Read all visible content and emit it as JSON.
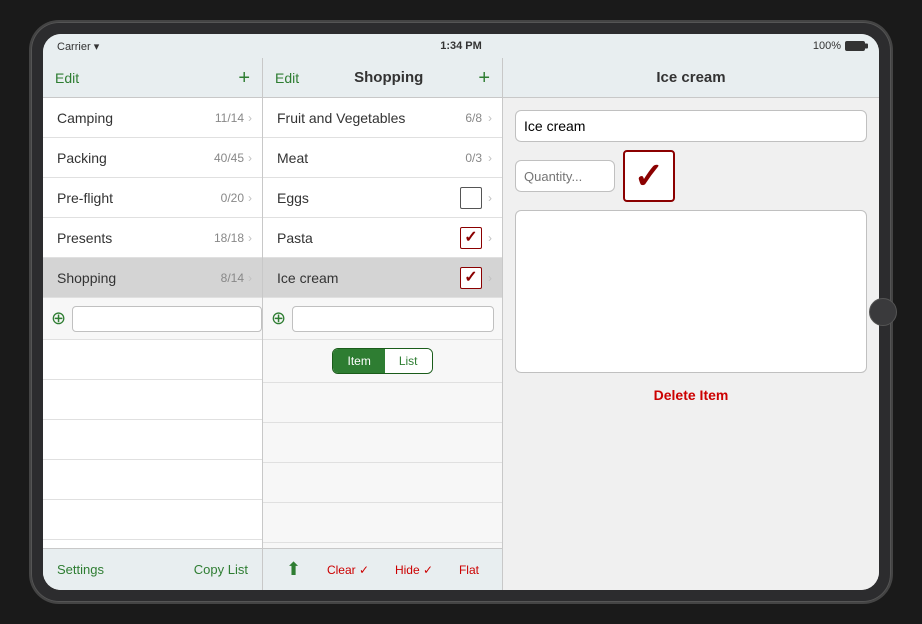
{
  "statusBar": {
    "carrier": "Carrier",
    "wifi": "▾",
    "time": "1:34 PM",
    "battery": "100%"
  },
  "leftPanel": {
    "editLabel": "Edit",
    "addLabel": "+",
    "lists": [
      {
        "name": "Camping",
        "count": "11/14"
      },
      {
        "name": "Packing",
        "count": "40/45"
      },
      {
        "name": "Pre-flight",
        "count": "0/20"
      },
      {
        "name": "Presents",
        "count": "18/18"
      },
      {
        "name": "Shopping",
        "count": "8/14",
        "active": true
      }
    ],
    "addInputPlaceholder": "",
    "footer": {
      "settings": "Settings",
      "copyList": "Copy List"
    }
  },
  "middlePanel": {
    "editLabel": "Edit",
    "addLabel": "+",
    "title": "Shopping",
    "items": [
      {
        "name": "Fruit and Vegetables",
        "count": "6/8",
        "checked": false,
        "active": false
      },
      {
        "name": "Meat",
        "count": "0/3",
        "checked": false,
        "active": false
      },
      {
        "name": "Eggs",
        "count": "",
        "checked": false,
        "active": false
      },
      {
        "name": "Pasta",
        "count": "",
        "checked": true,
        "active": false
      },
      {
        "name": "Ice cream",
        "count": "",
        "checked": true,
        "active": true
      }
    ],
    "addInputPlaceholder": "",
    "footer": {
      "clearLabel": "Clear ✓",
      "hideLabel": "Hide ✓",
      "flatLabel": "Flat"
    },
    "toggle": {
      "item": "Item",
      "list": "List",
      "active": "item"
    }
  },
  "rightPanel": {
    "title": "Ice cream",
    "itemName": "Ice cream",
    "quantityPlaceholder": "Quantity...",
    "checked": true,
    "deleteLabel": "Delete Item"
  }
}
